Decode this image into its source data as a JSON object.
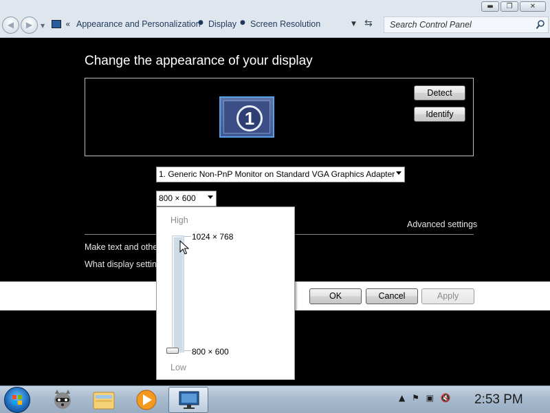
{
  "window": {
    "caption_buttons": [
      {
        "name": "minimize",
        "glyph": "▬"
      },
      {
        "name": "maximize",
        "glyph": "❐"
      },
      {
        "name": "close",
        "glyph": "✕"
      }
    ]
  },
  "address_bar": {
    "chevron": "«",
    "breadcrumbs": [
      "Appearance and Personalization",
      "Display",
      "Screen Resolution"
    ],
    "search_placeholder": "Search Control Panel",
    "icons": [
      "back-icon",
      "forward-icon",
      "control-panel-icon",
      "dropdown-icon",
      "refresh-icon",
      "search-icon"
    ]
  },
  "main": {
    "title": "Change the appearance of your display",
    "monitor_number": "1",
    "detect_label": "Detect",
    "identify_label": "Identify",
    "display_select": "1. Generic Non-PnP Monitor on Standard VGA Graphics Adapter",
    "resolution_select": "800 × 600",
    "advanced_settings": "Advanced settings",
    "link_text_size": "Make text and other items larger or smaller",
    "link_display_settings": "What display settings should I choose?",
    "ok_label": "OK",
    "cancel_label": "Cancel",
    "apply_label": "Apply"
  },
  "resolution_flyout": {
    "high_label": "High",
    "low_label": "Low",
    "top_resolution": "1024 × 768",
    "bottom_resolution": "800 × 600",
    "slider_value": 0
  },
  "taskbar": {
    "pinned": [
      "start-orb",
      "raccoon-app-icon",
      "file-explorer-icon",
      "media-player-icon",
      "display-settings-icon"
    ],
    "tray_icons": [
      "show-hidden-icon",
      "action-center-flag-icon",
      "network-icon",
      "volume-muted-icon"
    ],
    "clock": "2:53 PM"
  },
  "colors": {
    "background": "#000000",
    "address_bar": "#dfe6ee",
    "breadcrumb_text": "#1e395b",
    "taskbar": "#a8bbcf"
  }
}
